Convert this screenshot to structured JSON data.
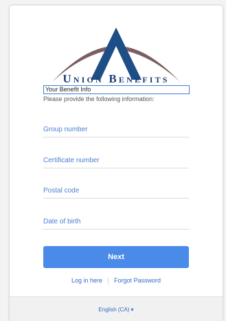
{
  "brand": {
    "name": "Union Benefits"
  },
  "form": {
    "heading": "Your Benefit Info",
    "subtitle": "Please provide the following information:",
    "fields": [
      {
        "placeholder": "Group number",
        "value": ""
      },
      {
        "placeholder": "Certificate number",
        "value": ""
      },
      {
        "placeholder": "Postal code",
        "value": ""
      },
      {
        "placeholder": "Date of birth",
        "value": ""
      }
    ],
    "next_label": "Next"
  },
  "links": {
    "login": "Log in here",
    "forgot": "Forgot Password"
  },
  "footer": {
    "language": "English (CA) ▾"
  },
  "colors": {
    "brand_navy": "#1d3f73",
    "accent": "#4a8ae8",
    "link": "#2f6bc8",
    "roof": "#8a6b6b"
  }
}
